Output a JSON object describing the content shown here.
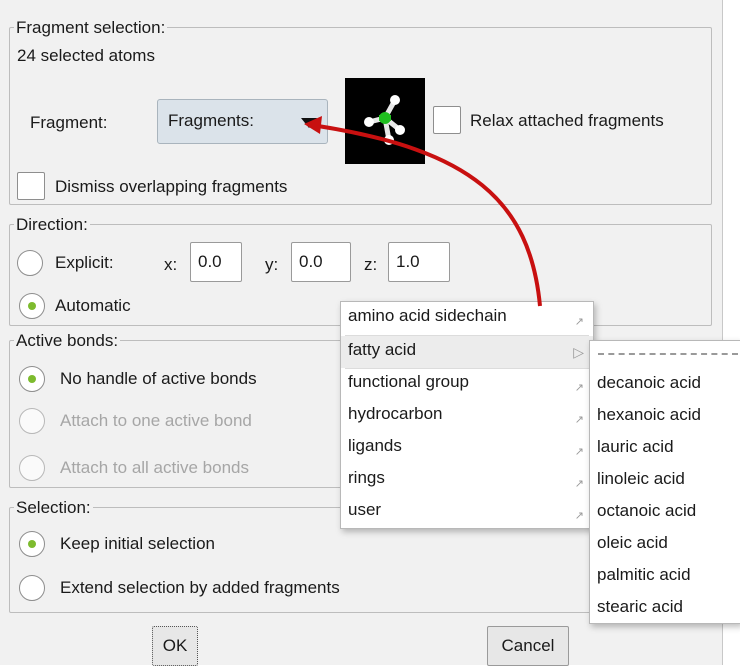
{
  "fragment_selection": {
    "legend": "Fragment selection:",
    "selected_atoms": "24 selected atoms",
    "fragment_label": "Fragment:",
    "fragment_combo": "Fragments:",
    "relax_label": "Relax attached fragments",
    "dismiss_label": "Dismiss overlapping fragments"
  },
  "direction": {
    "legend": "Direction:",
    "explicit_label": "Explicit:",
    "x_label": "x:",
    "x_value": "0.0",
    "y_label": "y:",
    "y_value": "0.0",
    "z_label": "z:",
    "z_value": "1.0",
    "automatic_label": "Automatic",
    "selected": "automatic"
  },
  "active_bonds": {
    "legend": "Active bonds:",
    "options": [
      "No handle of active bonds",
      "Attach to one active bond",
      "Attach to all active bonds"
    ],
    "selected": "No handle of active bonds"
  },
  "selection": {
    "legend": "Selection:",
    "options": [
      "Keep initial selection",
      "Extend selection by added fragments"
    ],
    "selected": "Keep initial selection"
  },
  "buttons": {
    "ok": "OK",
    "cancel": "Cancel"
  },
  "menu": {
    "items": [
      "amino acid sidechain",
      "fatty acid",
      "functional group",
      "hydrocarbon",
      "ligands",
      "rings",
      "user"
    ],
    "highlighted": "fatty acid"
  },
  "submenu": {
    "items": [
      "decanoic acid",
      "hexanoic acid",
      "lauric acid",
      "linoleic acid",
      "octanoic acid",
      "oleic acid",
      "palmitic acid",
      "stearic acid"
    ]
  },
  "colors": {
    "accent_green": "#7dbb2e",
    "annotation_arrow": "#c81010",
    "combo_bg": "#dbe3ea"
  }
}
